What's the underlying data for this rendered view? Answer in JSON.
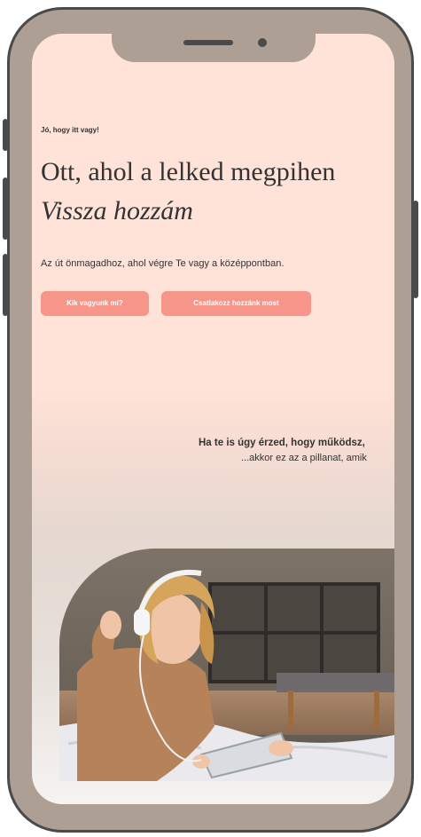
{
  "hero": {
    "eyebrow": "Jó, hogy itt vagy!",
    "headline": "Ott, ahol a lelked megpihen",
    "headline_italic": "Vissza hozzám",
    "tagline": "Az út önmagadhoz, ahol végre Te vagy a középpontban.",
    "primary_button": "Kik vagyunk mi?",
    "secondary_button": "Csatlakozz hozzánk most"
  },
  "intro": {
    "line1": "Ha te is úgy érzed, hogy működsz,",
    "line2": "...akkor ez az a pillanat, amik"
  },
  "colors": {
    "background": "#ffe2d8",
    "accent": "#f6958a",
    "text": "#333333",
    "frame": "#ad9f93"
  },
  "image": {
    "subject": "woman-with-headphones-and-tablet-photo"
  }
}
